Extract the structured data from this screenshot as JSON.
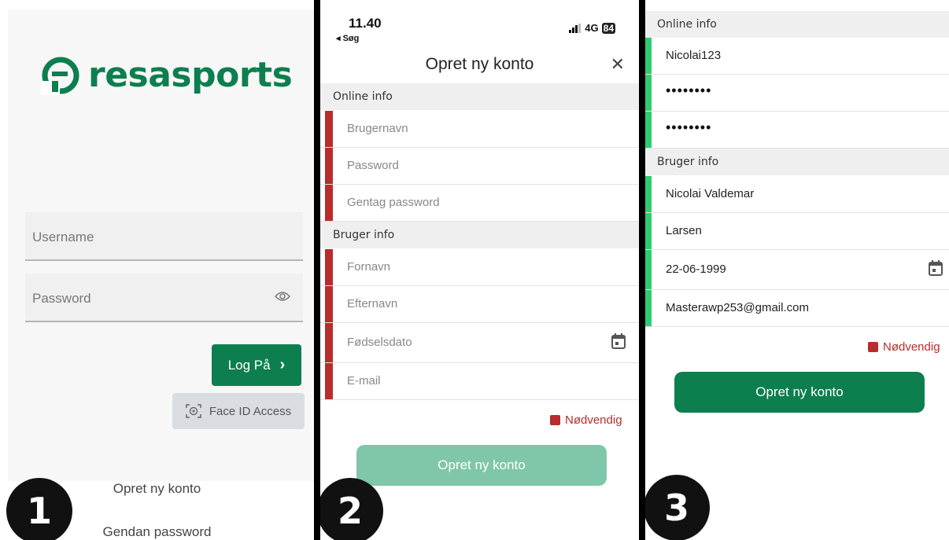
{
  "colors": {
    "brand_green": "#0d7f4e",
    "required_red": "#b82c2c",
    "valid_green": "#2ecc71",
    "disabled_green": "#80c6a9"
  },
  "panel1": {
    "brand": "resasports",
    "username_placeholder": "Username",
    "password_placeholder": "Password",
    "login_label": "Log På",
    "face_id_label": "Face ID Access",
    "create_account_link": "Opret ny konto",
    "reset_password_link": "Gendan password",
    "step_number": "1"
  },
  "panel2": {
    "status_time": "11.40",
    "status_back": "◂ Søg",
    "status_network": "4G",
    "status_battery": "84",
    "title": "Opret ny konto",
    "section_online": "Online info",
    "username_placeholder": "Brugernavn",
    "password_placeholder": "Password",
    "repeat_password_placeholder": "Gentag password",
    "section_user": "Bruger info",
    "firstname_placeholder": "Fornavn",
    "lastname_placeholder": "Efternavn",
    "birthdate_placeholder": "Fødselsdato",
    "email_placeholder": "E-mail",
    "required_label": "Nødvendig",
    "create_button": "Opret ny konto",
    "step_number": "2"
  },
  "panel3": {
    "section_online": "Online info",
    "username_value": "Nicolai123",
    "password_value": "••••••••",
    "repeat_password_value": "••••••••",
    "section_user": "Bruger info",
    "firstname_value": "Nicolai Valdemar",
    "lastname_value": "Larsen",
    "birthdate_value": "22-06-1999",
    "email_value": "Masterawp253@gmail.com",
    "required_label": "Nødvendig",
    "create_button": "Opret ny konto",
    "step_number": "3"
  }
}
